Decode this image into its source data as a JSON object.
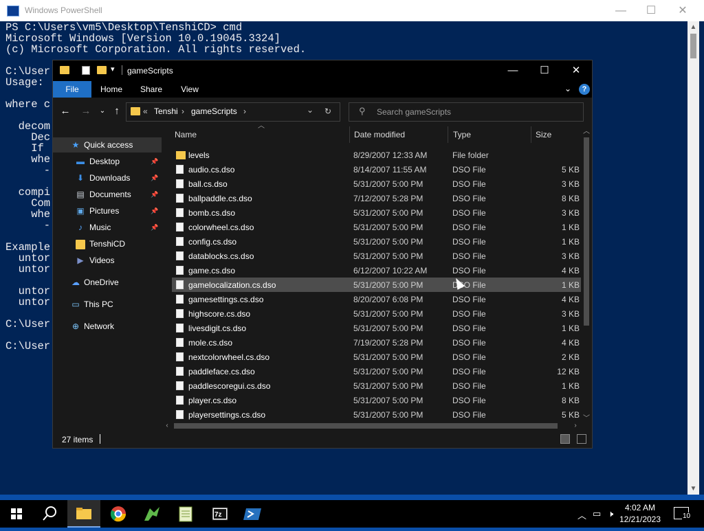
{
  "powershell": {
    "title": "Windows PowerShell",
    "lines": [
      "PS C:\\Users\\vm5\\Desktop\\TenshiCD> cmd",
      "Microsoft Windows [Version 10.0.19045.3324]",
      "(c) Microsoft Corporation. All rights reserved.",
      "",
      "C:\\User",
      "Usage:",
      "",
      "where c",
      "",
      "  decom",
      "    Dec",
      "    If",
      "    whe",
      "      -",
      "",
      "  compi",
      "    Com",
      "    whe",
      "      -",
      "",
      "Example",
      "  untor",
      "  untor",
      "",
      "  untor",
      "  untor",
      "",
      "C:\\User",
      "",
      "C:\\User"
    ]
  },
  "explorer": {
    "title": "gameScripts",
    "ribbon_tabs": [
      "File",
      "Home",
      "Share",
      "View"
    ],
    "address": {
      "prefix": "«",
      "crumbs": [
        "Tenshi",
        "gameScripts"
      ]
    },
    "search_placeholder": "Search gameScripts",
    "nav": {
      "quick_access": "Quick access",
      "items": [
        {
          "label": "Desktop",
          "icon": "desktop-icon",
          "pinned": true
        },
        {
          "label": "Downloads",
          "icon": "download-icon",
          "pinned": true
        },
        {
          "label": "Documents",
          "icon": "documents-icon",
          "pinned": true
        },
        {
          "label": "Pictures",
          "icon": "pictures-icon",
          "pinned": true
        },
        {
          "label": "Music",
          "icon": "music-icon",
          "pinned": true
        },
        {
          "label": "TenshiCD",
          "icon": "folder-icon",
          "pinned": false
        },
        {
          "label": "Videos",
          "icon": "videos-icon",
          "pinned": false
        }
      ],
      "onedrive": "OneDrive",
      "thispc": "This PC",
      "network": "Network"
    },
    "columns": [
      "Name",
      "Date modified",
      "Type",
      "Size"
    ],
    "files": [
      {
        "name": "levels",
        "date": "8/29/2007 12:33 AM",
        "type": "File folder",
        "size": "",
        "folder": true
      },
      {
        "name": "audio.cs.dso",
        "date": "8/14/2007 11:55 AM",
        "type": "DSO File",
        "size": "5 KB"
      },
      {
        "name": "ball.cs.dso",
        "date": "5/31/2007 5:00 PM",
        "type": "DSO File",
        "size": "3 KB"
      },
      {
        "name": "ballpaddle.cs.dso",
        "date": "7/12/2007 5:28 PM",
        "type": "DSO File",
        "size": "8 KB"
      },
      {
        "name": "bomb.cs.dso",
        "date": "5/31/2007 5:00 PM",
        "type": "DSO File",
        "size": "3 KB"
      },
      {
        "name": "colorwheel.cs.dso",
        "date": "5/31/2007 5:00 PM",
        "type": "DSO File",
        "size": "1 KB"
      },
      {
        "name": "config.cs.dso",
        "date": "5/31/2007 5:00 PM",
        "type": "DSO File",
        "size": "1 KB"
      },
      {
        "name": "datablocks.cs.dso",
        "date": "5/31/2007 5:00 PM",
        "type": "DSO File",
        "size": "3 KB"
      },
      {
        "name": "game.cs.dso",
        "date": "6/12/2007 10:22 AM",
        "type": "DSO File",
        "size": "4 KB"
      },
      {
        "name": "gamelocalization.cs.dso",
        "date": "5/31/2007 5:00 PM",
        "type": "DSO File",
        "size": "1 KB"
      },
      {
        "name": "gamesettings.cs.dso",
        "date": "8/20/2007 6:08 PM",
        "type": "DSO File",
        "size": "4 KB"
      },
      {
        "name": "highscore.cs.dso",
        "date": "5/31/2007 5:00 PM",
        "type": "DSO File",
        "size": "3 KB"
      },
      {
        "name": "livesdigit.cs.dso",
        "date": "5/31/2007 5:00 PM",
        "type": "DSO File",
        "size": "1 KB"
      },
      {
        "name": "mole.cs.dso",
        "date": "7/19/2007 5:28 PM",
        "type": "DSO File",
        "size": "4 KB"
      },
      {
        "name": "nextcolorwheel.cs.dso",
        "date": "5/31/2007 5:00 PM",
        "type": "DSO File",
        "size": "2 KB"
      },
      {
        "name": "paddleface.cs.dso",
        "date": "5/31/2007 5:00 PM",
        "type": "DSO File",
        "size": "12 KB"
      },
      {
        "name": "paddlescoregui.cs.dso",
        "date": "5/31/2007 5:00 PM",
        "type": "DSO File",
        "size": "1 KB"
      },
      {
        "name": "player.cs.dso",
        "date": "5/31/2007 5:00 PM",
        "type": "DSO File",
        "size": "8 KB"
      },
      {
        "name": "playersettings.cs.dso",
        "date": "5/31/2007 5:00 PM",
        "type": "DSO File",
        "size": "5 KB"
      }
    ],
    "hovered_row": 9,
    "status_count": "27 items"
  },
  "taskbar": {
    "apps": [
      "start-icon",
      "search-icon",
      "file-explorer-icon",
      "chrome-icon",
      "dragon-app-icon",
      "notepad-plus-icon",
      "7zip-icon",
      "powershell-icon"
    ],
    "active_app": "file-explorer-icon",
    "clock_time": "4:02 AM",
    "clock_date": "12/21/2023",
    "notification_count": "10",
    "colors": {
      "taskbar": "#000000",
      "accent": "#1f6fc5",
      "powershell_bg": "#012456"
    }
  }
}
